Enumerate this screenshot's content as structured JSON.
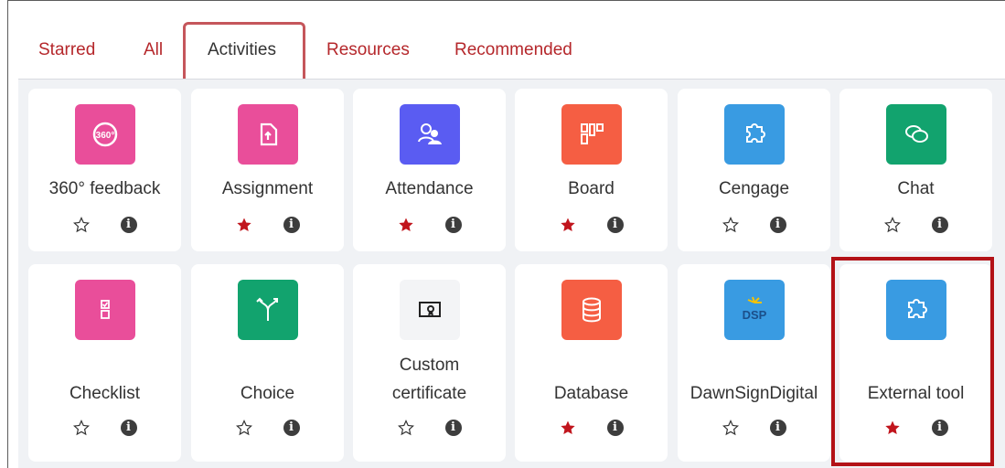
{
  "tabs": [
    {
      "label": "Starred"
    },
    {
      "label": "All"
    },
    {
      "label": "Activities"
    },
    {
      "label": "Resources"
    },
    {
      "label": "Recommended"
    }
  ],
  "active_tab": "Activities",
  "colors": {
    "pink": "#e94e9a",
    "indigo": "#5a5cf2",
    "orange": "#f55e43",
    "blue": "#399be2",
    "green": "#12a36e",
    "star_filled": "#c1151d",
    "link": "#b5272b"
  },
  "cards": [
    {
      "name": "360° feedback",
      "icon": "feedback-360-icon",
      "color": "pink",
      "starred": false
    },
    {
      "name": "Assignment",
      "icon": "assignment-icon",
      "color": "pink",
      "starred": true
    },
    {
      "name": "Attendance",
      "icon": "attendance-icon",
      "color": "indigo",
      "starred": true
    },
    {
      "name": "Board",
      "icon": "board-icon",
      "color": "orange",
      "starred": true
    },
    {
      "name": "Cengage",
      "icon": "puzzle-icon",
      "color": "blue",
      "starred": false
    },
    {
      "name": "Chat",
      "icon": "chat-icon",
      "color": "green",
      "starred": false
    },
    {
      "name": "Checklist",
      "icon": "checklist-icon",
      "color": "pink",
      "starred": false
    },
    {
      "name": "Choice",
      "icon": "choice-icon",
      "color": "green",
      "starred": false
    },
    {
      "name_lines": [
        "Custom",
        "certificate"
      ],
      "icon": "certificate-icon",
      "color": "white",
      "starred": false
    },
    {
      "name": "Database",
      "icon": "database-icon",
      "color": "orange",
      "starred": true
    },
    {
      "name": "DawnSignDigital",
      "icon": "dsp-logo-icon",
      "color": "blue",
      "starred": false,
      "logo_text": "DSP"
    },
    {
      "name": "External tool",
      "icon": "puzzle-icon",
      "color": "blue",
      "starred": true
    }
  ]
}
